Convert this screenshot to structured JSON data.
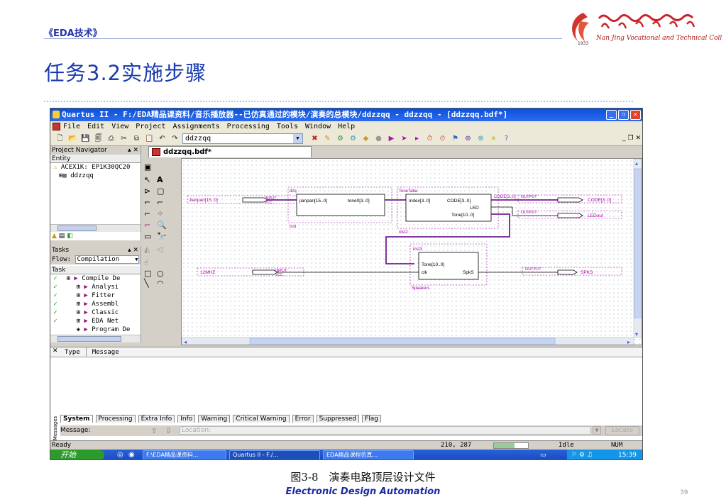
{
  "slide": {
    "course": "《EDA技术》",
    "title": "任务3.2实施步骤",
    "caption": "图3-8　演奏电路顶层设计文件",
    "footer": "Electronic Design Automation",
    "page_number": "39",
    "college_name": "Nan Jing Vocational and Technical College",
    "college_year": "1933"
  },
  "window": {
    "title": "Quartus II - F:/EDA精品课资料/音乐播放器--已仿真通过的模块/演奏的总模块/ddzzqq - ddzzqq - [ddzzqq.bdf*]",
    "menu": [
      "File",
      "Edit",
      "View",
      "Project",
      "Assignments",
      "Processing",
      "Tools",
      "Window",
      "Help"
    ],
    "toolbar_combo": "ddzzqq"
  },
  "navigator": {
    "title": "Project Navigator",
    "header": "Entity",
    "device": "ACEX1K: EP1K30QC20",
    "top_entity": "ddzzqq"
  },
  "tasks": {
    "title": "Tasks",
    "flow_label": "Flow:",
    "flow_value": "Compilation",
    "col_header": "Task",
    "items": [
      "Compile De",
      "Analysi",
      "Fitter",
      "Assembl",
      "Classic",
      "EDA Net",
      "Program De"
    ]
  },
  "document": {
    "tab": "ddzzqq.bdf*"
  },
  "schematic": {
    "in_jianpan_name": "Jianpan[15..0]",
    "in_clk_name": "12MHZ",
    "input_label": "INPUT",
    "vcc": "VCC",
    "output_label": "OUTPUT",
    "out_code": "CODE[3..0]",
    "out_led": "LEDout",
    "out_spks": "SPKS",
    "dzq_name": "dzq",
    "dzq_in": "jianpan[15..0]",
    "dzq_out": "tone0[3..0]",
    "dzq_inst": "inst",
    "tonetaba_name": "ToneTaba",
    "tonetaba_in": "Index[3..0]",
    "tonetaba_out1": "CODE[3..0]",
    "tonetaba_out2": "LED",
    "tonetaba_out3": "Tone[10..0]",
    "tonetaba_inst": "inst2",
    "spk_inst": "inst3",
    "spk_in1": "Tone[10..0]",
    "spk_in2": "clk",
    "spk_out": "SpkS",
    "spk_name": "Speakers",
    "wire_code": "CODE[3..0]"
  },
  "messages": {
    "col_type": "Type",
    "col_message": "Message",
    "side_label": "Messages",
    "tabs": [
      "System",
      "Processing",
      "Extra Info",
      "Info",
      "Warning",
      "Critical Warning",
      "Error",
      "Suppressed",
      "Flag"
    ],
    "message_label": "Message:",
    "location_placeholder": "Location:",
    "locate_button": "Locate"
  },
  "status": {
    "left": "Ready",
    "coords": "210, 287",
    "state": "Idle",
    "num": "NUM"
  },
  "taskbar": {
    "start": "开始",
    "items": [
      "F:\\EDA精品课资料...",
      "Quartus II - F:/...",
      "EDA精品课程仿真..."
    ],
    "clock": "15:39"
  }
}
